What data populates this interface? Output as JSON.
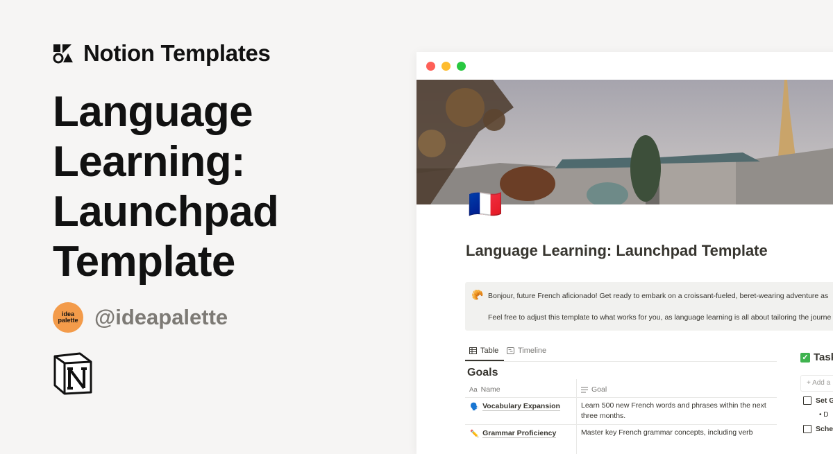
{
  "brand": {
    "name": "Notion Templates",
    "logo_icon": "notion-templates-logo-icon"
  },
  "headline": {
    "lines": [
      "Language",
      "Learning:",
      "Launchpad",
      "Template"
    ]
  },
  "author": {
    "avatar_line1": "idea",
    "avatar_line2": "palette",
    "handle": "@ideapalette",
    "avatar_color": "#f39b4a"
  },
  "notion_logo": "notion-logo-icon",
  "window": {
    "traffic_lights": [
      "#fe5f57",
      "#febc2e",
      "#28c840"
    ],
    "page_icon": "🇫🇷",
    "page_title": "Language Learning: Launchpad Template",
    "callout": {
      "icon": "🥐",
      "line1": "Bonjour, future French aficionado! Get ready to embark on a croissant-fueled, beret-wearing adventure as",
      "line2": "Feel free to adjust this template to what works for you, as language learning is all about tailoring the journe"
    },
    "tabs": [
      {
        "label": "Table",
        "icon": "table-icon"
      },
      {
        "label": "Timeline",
        "icon": "timeline-icon"
      }
    ],
    "database": {
      "title": "Goals",
      "columns": [
        {
          "label": "Name",
          "icon": "Aa"
        },
        {
          "label": "Goal",
          "icon": "text-lines-icon"
        }
      ],
      "rows": [
        {
          "icon": "🗣️",
          "name": "Vocabulary Expansion",
          "goal": "Learn 500 new French words and phrases within the next three months."
        },
        {
          "icon": "✏️",
          "name": "Grammar Proficiency",
          "goal": "Master key French grammar concepts, including verb"
        }
      ]
    },
    "tasks": {
      "title": "Tasks",
      "add_label": "+ Add a",
      "items": [
        {
          "label": "Set G"
        },
        {
          "label": "Sche"
        }
      ],
      "sub_bullet": "D"
    }
  }
}
